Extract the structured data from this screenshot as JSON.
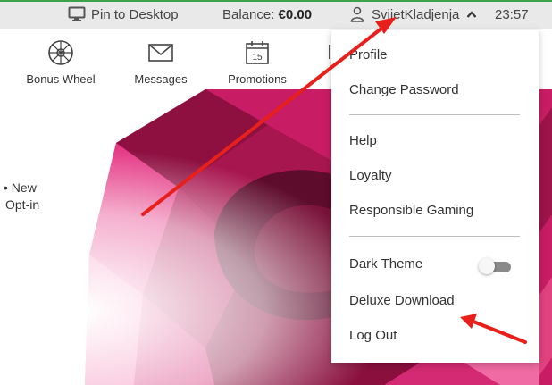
{
  "topbar": {
    "pin_label": "Pin to Desktop",
    "balance_label": "Balance:",
    "balance_value": "€0.00",
    "username": "SvijetKladjenja",
    "time": "23:57"
  },
  "nav": {
    "items": [
      {
        "label": "Bonus Wheel",
        "icon": "wheel-icon"
      },
      {
        "label": "Messages",
        "icon": "envelope-icon"
      },
      {
        "label": "Promotions",
        "icon": "calendar-icon",
        "badge": "15"
      }
    ]
  },
  "side_note": {
    "line1": "New",
    "line2": "Opt-in"
  },
  "user_menu": {
    "items": [
      {
        "label": "Profile"
      },
      {
        "label": "Change Password"
      },
      {
        "label": "Help"
      },
      {
        "label": "Loyalty"
      },
      {
        "label": "Responsible Gaming"
      },
      {
        "label": "Dark Theme"
      },
      {
        "label": "Deluxe Download"
      },
      {
        "label": "Log Out"
      }
    ],
    "dark_theme_enabled": false
  },
  "colors": {
    "topbar_bg": "#e9e9e9",
    "topbar_accent": "#3aa34a",
    "gem": "#e0126a",
    "annotation_arrow": "#e8201c"
  }
}
